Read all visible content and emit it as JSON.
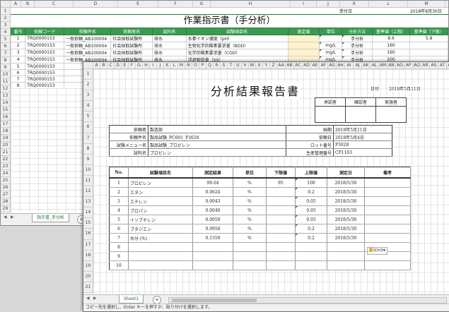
{
  "back": {
    "columns": [
      "A",
      "B",
      "C",
      "D",
      "E",
      "F",
      "G",
      "H",
      "I",
      "J",
      "K",
      "L",
      "M",
      "N",
      "O"
    ],
    "row_numbers": [
      "1",
      "2",
      "3",
      "4",
      "5",
      "6",
      "7",
      "8",
      "9",
      "10",
      "11",
      "12",
      "13",
      "14",
      "15",
      "16",
      "17",
      "18",
      "19",
      "20",
      "21",
      "22",
      "23",
      "24",
      "25",
      "26",
      "27",
      "28",
      "29"
    ],
    "receipt_label": "受付日",
    "receipt_date": "2018年8月30日",
    "title": "作業指示書（手分析）",
    "headers": [
      "番号",
      "依頼コード",
      "依頼件名",
      "依頼者名",
      "試料名",
      "試験項目名",
      "測定値",
      "単位",
      "分析方法",
      "基準値（上限）",
      "基準値（下限）"
    ],
    "rows": [
      [
        "1",
        "TRQ0000153",
        "一般依頼_AB100004",
        "社会採取試験所",
        "排水",
        "水素イオン濃度（pH）",
        "",
        "",
        "手分析",
        "8.6",
        "5.8"
      ],
      [
        "2",
        "TRQ0000153",
        "一般依頼_AB100004",
        "社会採取試験所",
        "排水",
        "生物化学的酸素要求量（BOD）",
        "",
        "mg/L",
        "手分析",
        "160",
        ""
      ],
      [
        "3",
        "TRQ0000153",
        "一般依頼_AB100004",
        "社会採取試験所",
        "排水",
        "化学的酸素要求量（COD）",
        "",
        "mg/L",
        "手分析",
        "160",
        ""
      ],
      [
        "4",
        "TRQ0000153",
        "一般依頼_AB100004",
        "社会採取試験所",
        "排水",
        "浮遊物質量（SS）",
        "",
        "mg/L",
        "手分析",
        "200",
        ""
      ],
      [
        "5",
        "TRQ0000153",
        "",
        "",
        "",
        "",
        "",
        "",
        "",
        "",
        ""
      ],
      [
        "6",
        "TRQ0000153",
        "",
        "",
        "",
        "",
        "",
        "",
        "",
        "",
        ""
      ],
      [
        "7",
        "TRQ0000153",
        "",
        "",
        "",
        "",
        "",
        "",
        "",
        "",
        ""
      ],
      [
        "8",
        "TRQ0000153",
        "",
        "",
        "",
        "",
        "",
        "",
        "",
        "",
        ""
      ]
    ],
    "sheet_tab": "指示書_手分析"
  },
  "front": {
    "columns": [
      "A",
      "B",
      "C",
      "D",
      "E",
      "F",
      "G",
      "H",
      "I",
      "J",
      "K",
      "L",
      "M",
      "N",
      "O",
      "P",
      "Q",
      "R",
      "S",
      "T",
      "U",
      "V",
      "W",
      "X",
      "Y",
      "Z",
      "AA",
      "AB",
      "AC",
      "AD",
      "AE",
      "AF",
      "AG",
      "AH",
      "AI",
      "AJ",
      "AK",
      "AL",
      "AM",
      "AN",
      "AO",
      "AP",
      "AQ",
      "AR",
      "AS",
      "AT",
      "AU",
      "AV",
      "AW",
      "AX",
      "AY",
      "AZ"
    ],
    "row_numbers": [
      "1",
      "2",
      "3",
      "4",
      "5",
      "6",
      "7",
      "8",
      "9",
      "10",
      "11",
      "12",
      "13",
      "14",
      "15",
      "16",
      "17",
      "18",
      "19",
      "20",
      "21"
    ],
    "title": "分析結果報告書",
    "date_label": "日付",
    "date_value": "2018年5月11日",
    "approvals": [
      "承認者",
      "確認者",
      "実施者"
    ],
    "info_left": [
      {
        "label": "依頼者",
        "value": "製造部"
      },
      {
        "label": "依頼件名",
        "value": "製品試験_PC001_P3028"
      },
      {
        "label": "試験メニュー名",
        "value": "製品試験_プロピレン"
      },
      {
        "label": "試料名",
        "value": "プロピレン"
      }
    ],
    "info_right": [
      {
        "label": "納期",
        "value": "2018年5月11日"
      },
      {
        "label": "依頼日",
        "value": "2018年5月4日"
      },
      {
        "label": "ロット番号",
        "value": "P3028"
      },
      {
        "label": "生産管理番号",
        "value": "CP1103"
      }
    ],
    "result_headers": [
      "No.",
      "試験項目名",
      "測定結果",
      "単位",
      "下限値",
      "上限値",
      "測定日",
      "備考"
    ],
    "results": [
      [
        "1",
        "プロピレン",
        "99.04",
        "%",
        "95",
        "100",
        "2018/5/30",
        ""
      ],
      [
        "2",
        "エタン",
        "0.0624",
        "%",
        "",
        "0.2",
        "2018/5/30",
        ""
      ],
      [
        "3",
        "エチレン",
        "0.0043",
        "%",
        "",
        "0.05",
        "2018/5/30",
        ""
      ],
      [
        "4",
        "プロパン",
        "0.0040",
        "%",
        "",
        "0.05",
        "2018/5/30",
        ""
      ],
      [
        "5",
        "イソブチレン",
        "0.0050",
        "%",
        "",
        "0.05",
        "2018/5/30",
        ""
      ],
      [
        "6",
        "ブタジエン",
        "0.0958",
        "%",
        "",
        "0.2",
        "2018/5/30",
        ""
      ],
      [
        "7",
        "水分 (%)",
        "0.1350",
        "%",
        "",
        "0.2",
        "2018/5/30",
        ""
      ],
      [
        "8",
        "",
        "",
        "",
        "",
        "",
        "",
        ""
      ],
      [
        "9",
        "",
        "",
        "",
        "",
        "",
        "",
        ""
      ],
      [
        "10",
        "",
        "",
        "",
        "",
        "",
        "",
        ""
      ]
    ],
    "paste_badge": "(Ctrl)",
    "sheet_tab": "Sheet1",
    "status_text": "コピー先を選択し、Enter キーを押すか、貼り付けを選択します。"
  }
}
